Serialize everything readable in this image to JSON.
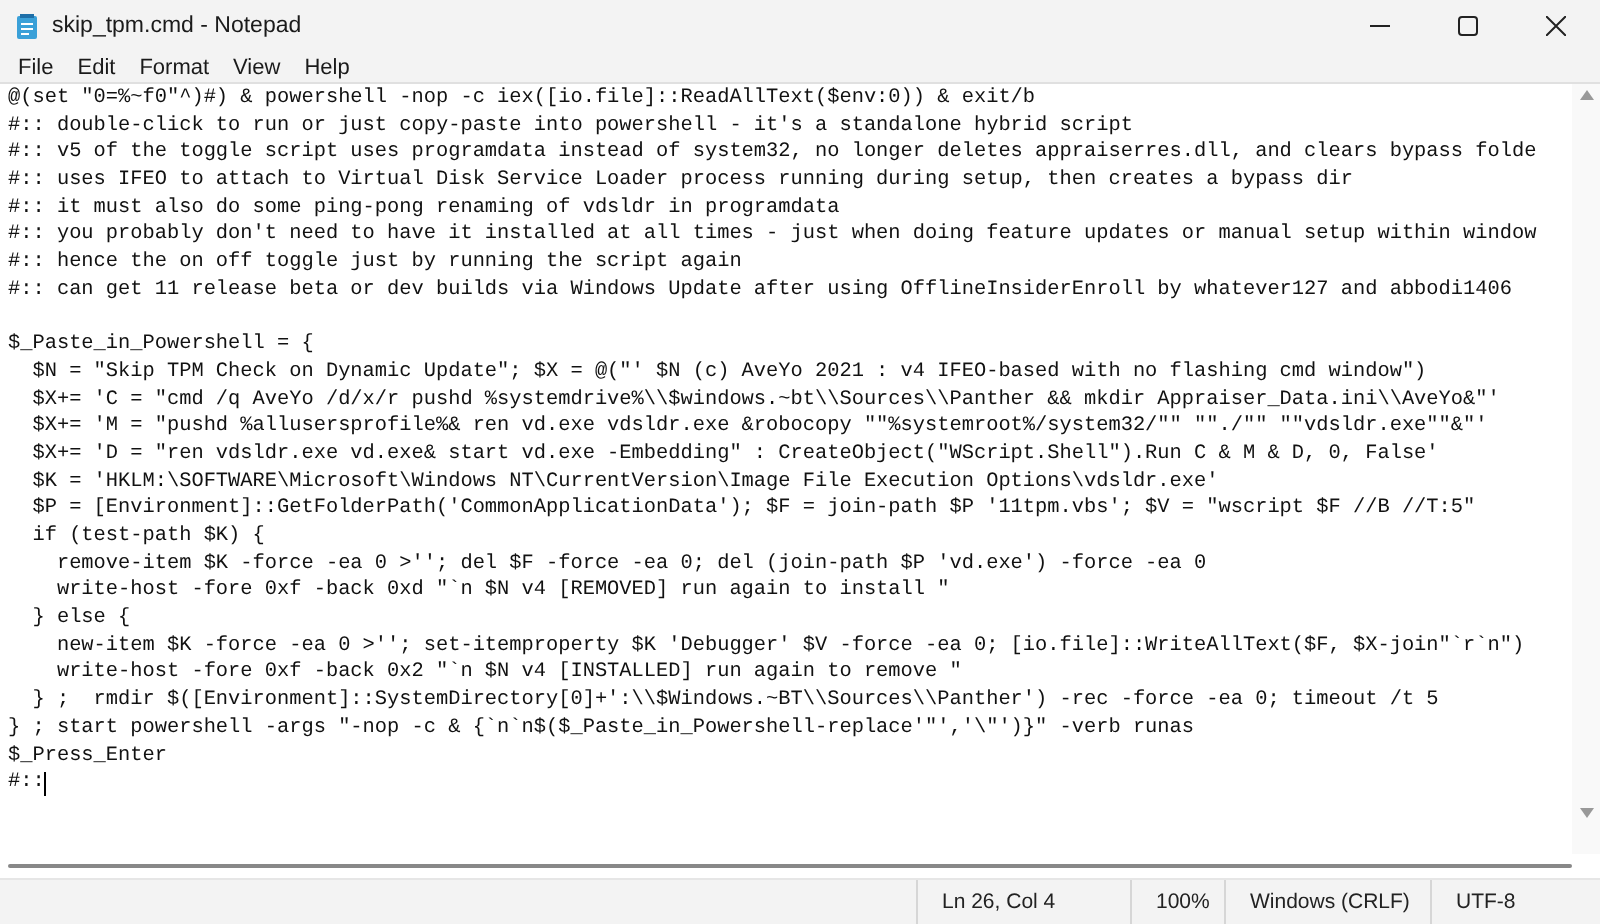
{
  "window": {
    "title": "skip_tpm.cmd - Notepad"
  },
  "menu": [
    "File",
    "Edit",
    "Format",
    "View",
    "Help"
  ],
  "editor": {
    "blocks": [
      [
        "@(set \"0=%~f0\"^)#) & powershell -nop -c iex([io.file]::ReadAllText($env:0)) & exit/b",
        "#:: double-click to run or just copy-paste into powershell - it's a standalone hybrid script",
        "#:: v5 of the toggle script uses programdata instead of system32, no longer deletes appraiserres.dll, and clears bypass folde",
        "#:: uses IFEO to attach to Virtual Disk Service Loader process running during setup, then creates a bypass dir",
        "#:: it must also do some ping-pong renaming of vdsldr in programdata",
        "#:: you probably don't need to have it installed at all times - just when doing feature updates or manual setup within window",
        "#:: hence the on off toggle just by running the script again",
        "#:: can get 11 release beta or dev builds via Windows Update after using OfflineInsiderEnroll by whatever127 and abbodi1406"
      ],
      [
        "$_Paste_in_Powershell = {",
        "  $N = \"Skip TPM Check on Dynamic Update\"; $X = @(\"' $N (c) AveYo 2021 : v4 IFEO-based with no flashing cmd window\")",
        "  $X+= 'C = \"cmd /q AveYo /d/x/r pushd %systemdrive%\\\\$windows.~bt\\\\Sources\\\\Panther && mkdir Appraiser_Data.ini\\\\AveYo&\"'",
        "  $X+= 'M = \"pushd %allusersprofile%& ren vd.exe vdsldr.exe &robocopy \"\"%systemroot%/system32/\"\" \"\"./\"\" \"\"vdsldr.exe\"\"&\"'",
        "  $X+= 'D = \"ren vdsldr.exe vd.exe& start vd.exe -Embedding\" : CreateObject(\"WScript.Shell\").Run C & M & D, 0, False'",
        "  $K = 'HKLM:\\SOFTWARE\\Microsoft\\Windows NT\\CurrentVersion\\Image File Execution Options\\vdsldr.exe'",
        "  $P = [Environment]::GetFolderPath('CommonApplicationData'); $F = join-path $P '11tpm.vbs'; $V = \"wscript $F //B //T:5\"",
        "  if (test-path $K) {",
        "    remove-item $K -force -ea 0 >''; del $F -force -ea 0; del (join-path $P 'vd.exe') -force -ea 0",
        "    write-host -fore 0xf -back 0xd \"`n $N v4 [REMOVED] run again to install \"",
        "  } else {",
        "    new-item $K -force -ea 0 >''; set-itemproperty $K 'Debugger' $V -force -ea 0; [io.file]::WriteAllText($F, $X-join\"`r`n\")",
        "    write-host -fore 0xf -back 0x2 \"`n $N v4 [INSTALLED] run again to remove \"",
        "  } ;  rmdir $([Environment]::SystemDirectory[0]+':\\\\$Windows.~BT\\\\Sources\\\\Panther') -rec -force -ea 0; timeout /t 5",
        "} ; start powershell -args \"-nop -c & {`n`n$($_Paste_in_Powershell-replace'\"','\\\"')}\" -verb runas",
        "$_Press_Enter",
        "#::"
      ]
    ]
  },
  "status_bar": {
    "position": "Ln 26, Col 4",
    "zoom": "100%",
    "line_ending": "Windows (CRLF)",
    "encoding": "UTF-8"
  }
}
